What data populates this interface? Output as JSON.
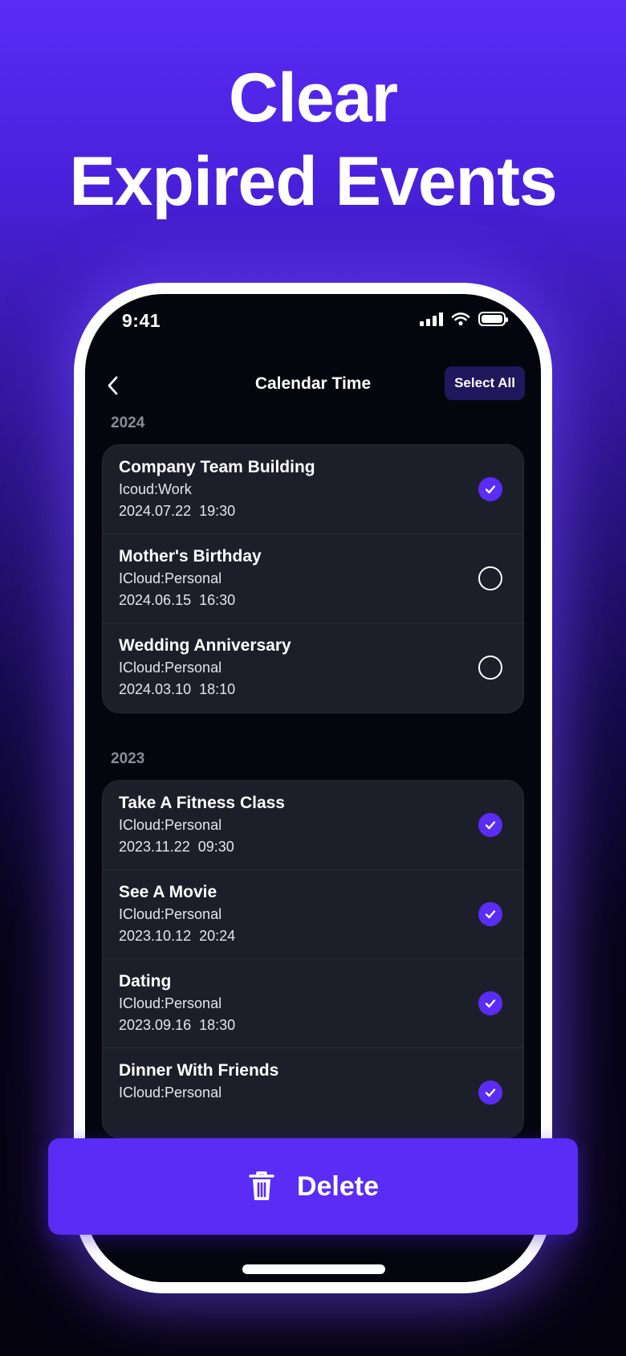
{
  "headline": {
    "line1": "Clear",
    "line2": "Expired Events"
  },
  "status_bar": {
    "time": "9:41"
  },
  "nav": {
    "title": "Calendar Time",
    "select_all": "Select All"
  },
  "groups": [
    {
      "year": "2024",
      "events": [
        {
          "title": "Company Team Building",
          "calendar": "Icoud:Work",
          "datetime": "2024.07.22  19:30",
          "selected": true
        },
        {
          "title": "Mother's Birthday",
          "calendar": "ICloud:Personal",
          "datetime": "2024.06.15  16:30",
          "selected": false
        },
        {
          "title": "Wedding Anniversary",
          "calendar": "ICloud:Personal",
          "datetime": "2024.03.10  18:10",
          "selected": false
        }
      ]
    },
    {
      "year": "2023",
      "events": [
        {
          "title": "Take A Fitness Class",
          "calendar": "ICloud:Personal",
          "datetime": "2023.11.22  09:30",
          "selected": true
        },
        {
          "title": "See A Movie",
          "calendar": "ICloud:Personal",
          "datetime": "2023.10.12  20:24",
          "selected": true
        },
        {
          "title": "Dating",
          "calendar": "ICloud:Personal",
          "datetime": "2023.09.16  18:30",
          "selected": true
        },
        {
          "title": "Dinner With Friends",
          "calendar": "ICloud:Personal",
          "datetime": "",
          "selected": true
        }
      ]
    }
  ],
  "delete_button": {
    "label": "Delete"
  },
  "colors": {
    "accent": "#5a2cf5",
    "screen_bg": "#05060d",
    "card_bg": "#1c1f2a",
    "select_all_bg": "#20185c"
  },
  "icons": {
    "back": "chevron-left-icon",
    "check": "check-icon",
    "delete": "trash-icon"
  }
}
